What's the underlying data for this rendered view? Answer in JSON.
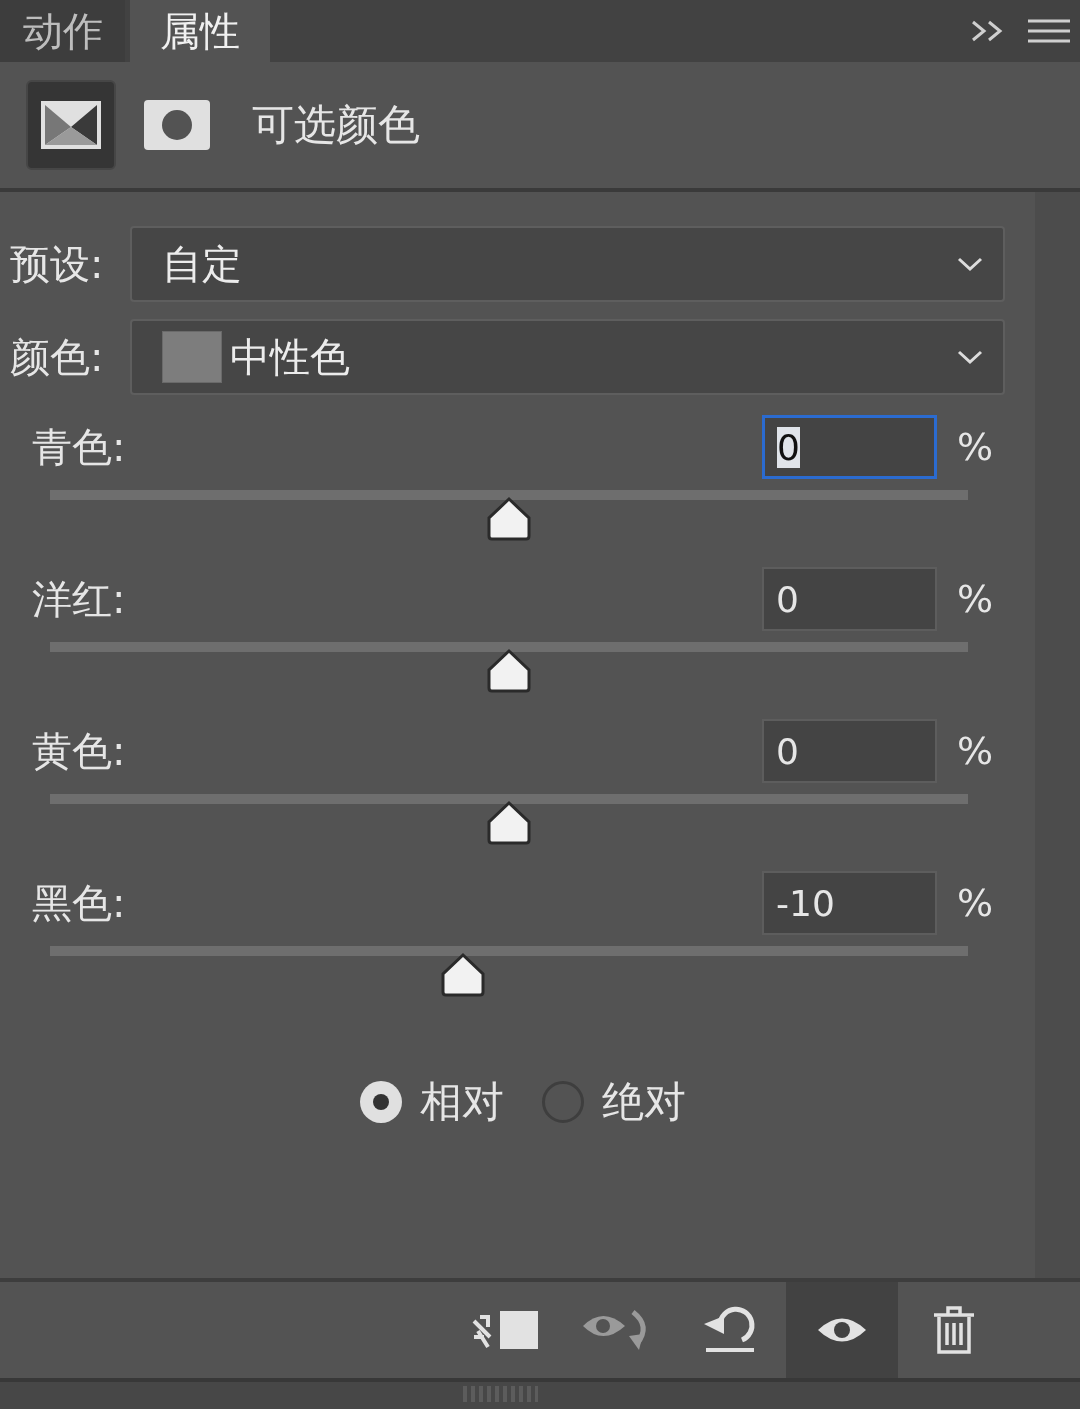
{
  "tabs": [
    {
      "label": "动作",
      "selected": false
    },
    {
      "label": "属性",
      "selected": true
    }
  ],
  "header": {
    "title": "可选颜色",
    "modes": [
      {
        "kind": "adjustment",
        "selected": true
      },
      {
        "kind": "mask",
        "selected": false
      }
    ]
  },
  "preset": {
    "label": "预设:",
    "value": "自定"
  },
  "color": {
    "label": "颜色:",
    "value": "中性色"
  },
  "sliders": [
    {
      "label": "青色:",
      "value": "0",
      "unit": "%",
      "level": 0.5,
      "focused": true
    },
    {
      "label": "洋红:",
      "value": "0",
      "unit": "%",
      "level": 0.5,
      "focused": false
    },
    {
      "label": "黄色:",
      "value": "0",
      "unit": "%",
      "level": 0.5,
      "focused": false
    },
    {
      "label": "黑色:",
      "value": "-10",
      "unit": "%",
      "level": 0.45,
      "focused": false
    }
  ],
  "method": [
    {
      "label": "相对",
      "selected": true
    },
    {
      "label": "绝对",
      "selected": false
    }
  ],
  "toolbar": [
    {
      "kind": "clip",
      "disabled": false,
      "selected": false
    },
    {
      "kind": "previous",
      "disabled": true,
      "selected": false
    },
    {
      "kind": "reset",
      "disabled": false,
      "selected": false
    },
    {
      "kind": "visibility",
      "disabled": false,
      "selected": true
    },
    {
      "kind": "delete",
      "disabled": false,
      "selected": false
    }
  ]
}
